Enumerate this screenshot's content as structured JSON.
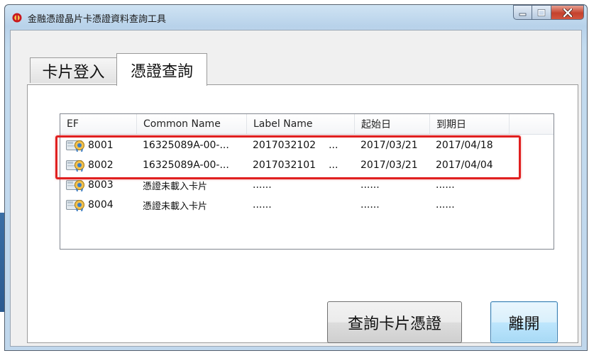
{
  "window": {
    "title": "金融憑證晶片卡憑證資料查詢工具",
    "accent_color": "#c4412d"
  },
  "tabs": [
    {
      "label": "卡片登入",
      "active": false
    },
    {
      "label": "憑證查詢",
      "active": true
    }
  ],
  "table": {
    "columns": [
      "EF",
      "Common Name",
      "Label Name",
      "起始日",
      "到期日"
    ],
    "rows": [
      {
        "ef": "8001",
        "common_name": "16325089A-00-...",
        "label_name": "2017032102",
        "label_more": "...",
        "start": "2017/03/21",
        "end": "2017/04/18",
        "highlighted": true
      },
      {
        "ef": "8002",
        "common_name": "16325089A-00-...",
        "label_name": "2017032101",
        "label_more": "...",
        "start": "2017/03/21",
        "end": "2017/04/04",
        "highlighted": true
      },
      {
        "ef": "8003",
        "common_name": "憑證未載入卡片",
        "label_name": "......",
        "label_more": "",
        "start": "......",
        "end": "......",
        "highlighted": false
      },
      {
        "ef": "8004",
        "common_name": "憑證未載入卡片",
        "label_name": "......",
        "label_more": "",
        "start": "......",
        "end": "......",
        "highlighted": false
      }
    ],
    "icon": "smartcard-icon",
    "highlight_color": "#e02020"
  },
  "buttons": {
    "query_label": "查詢卡片憑證",
    "exit_label": "離開"
  }
}
